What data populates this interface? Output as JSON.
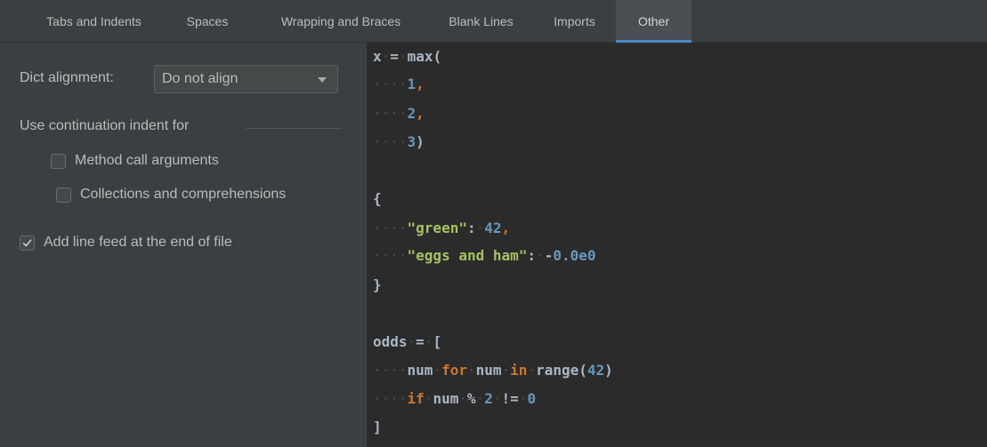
{
  "tabs": [
    {
      "label": "Tabs and Indents",
      "active": false
    },
    {
      "label": "Spaces",
      "active": false
    },
    {
      "label": "Wrapping and Braces",
      "active": false
    },
    {
      "label": "Blank Lines",
      "active": false
    },
    {
      "label": "Imports",
      "active": false
    },
    {
      "label": "Other",
      "active": true
    }
  ],
  "settings": {
    "dict_alignment_label": "Dict alignment:",
    "dict_alignment_value": "Do not align",
    "continuation_header": "Use continuation indent for",
    "method_call_label": "Method call arguments",
    "method_call_checked": false,
    "collections_label": "Collections and comprehensions",
    "collections_checked": false,
    "line_feed_label": "Add line feed at the end of file",
    "line_feed_checked": true
  },
  "colors": {
    "accent": "#4a88c7",
    "editor_bg": "#2b2b2b",
    "panel_bg": "#3c3f41",
    "keyword": "#cc7832",
    "string": "#a5c261",
    "number": "#6897bb",
    "text": "#a9b7c6"
  },
  "code": {
    "lines": [
      [
        {
          "t": "x",
          "c": "txt"
        },
        {
          "t": "·",
          "c": "ws"
        },
        {
          "t": "=",
          "c": "txt"
        },
        {
          "t": "·",
          "c": "ws"
        },
        {
          "t": "max(",
          "c": "txt"
        }
      ],
      [
        {
          "t": "····",
          "c": "ws"
        },
        {
          "t": "1",
          "c": "num"
        },
        {
          "t": ",",
          "c": "kw"
        }
      ],
      [
        {
          "t": "····",
          "c": "ws"
        },
        {
          "t": "2",
          "c": "num"
        },
        {
          "t": ",",
          "c": "kw"
        }
      ],
      [
        {
          "t": "····",
          "c": "ws"
        },
        {
          "t": "3",
          "c": "num"
        },
        {
          "t": ")",
          "c": "txt"
        }
      ],
      [],
      [
        {
          "t": "{",
          "c": "txt"
        }
      ],
      [
        {
          "t": "····",
          "c": "ws"
        },
        {
          "t": "\"green\"",
          "c": "str"
        },
        {
          "t": ":",
          "c": "txt"
        },
        {
          "t": "·",
          "c": "ws"
        },
        {
          "t": "42",
          "c": "num"
        },
        {
          "t": ",",
          "c": "kw"
        }
      ],
      [
        {
          "t": "····",
          "c": "ws"
        },
        {
          "t": "\"eggs and ham\"",
          "c": "str"
        },
        {
          "t": ":",
          "c": "txt"
        },
        {
          "t": "·",
          "c": "ws"
        },
        {
          "t": "-",
          "c": "txt"
        },
        {
          "t": "0.0e0",
          "c": "num"
        }
      ],
      [
        {
          "t": "}",
          "c": "txt"
        }
      ],
      [],
      [
        {
          "t": "odds",
          "c": "txt"
        },
        {
          "t": "·",
          "c": "ws"
        },
        {
          "t": "=",
          "c": "txt"
        },
        {
          "t": "·",
          "c": "ws"
        },
        {
          "t": "[",
          "c": "txt"
        }
      ],
      [
        {
          "t": "····",
          "c": "ws"
        },
        {
          "t": "num",
          "c": "txt"
        },
        {
          "t": "·",
          "c": "ws"
        },
        {
          "t": "for",
          "c": "kw"
        },
        {
          "t": "·",
          "c": "ws"
        },
        {
          "t": "num",
          "c": "txt"
        },
        {
          "t": "·",
          "c": "ws"
        },
        {
          "t": "in",
          "c": "kw"
        },
        {
          "t": "·",
          "c": "ws"
        },
        {
          "t": "range(",
          "c": "txt"
        },
        {
          "t": "42",
          "c": "num"
        },
        {
          "t": ")",
          "c": "txt"
        }
      ],
      [
        {
          "t": "····",
          "c": "ws"
        },
        {
          "t": "if",
          "c": "kw"
        },
        {
          "t": "·",
          "c": "ws"
        },
        {
          "t": "num",
          "c": "txt"
        },
        {
          "t": "·",
          "c": "ws"
        },
        {
          "t": "%",
          "c": "txt"
        },
        {
          "t": "·",
          "c": "ws"
        },
        {
          "t": "2",
          "c": "num"
        },
        {
          "t": "·",
          "c": "ws"
        },
        {
          "t": "!=",
          "c": "txt"
        },
        {
          "t": "·",
          "c": "ws"
        },
        {
          "t": "0",
          "c": "num"
        }
      ],
      [
        {
          "t": "]",
          "c": "txt"
        }
      ]
    ]
  }
}
